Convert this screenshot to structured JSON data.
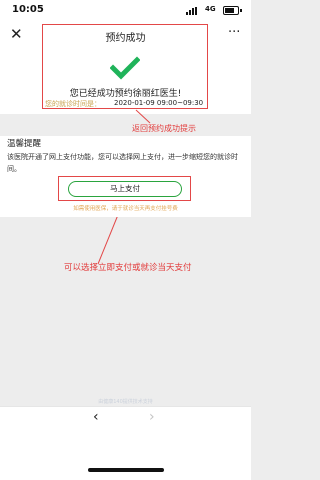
{
  "status_bar": {
    "time": "10:05",
    "network": "4G"
  },
  "nav": {
    "close_glyph": "✕",
    "title": "预约成功",
    "more_glyph": "···"
  },
  "success": {
    "icon": "check-icon",
    "message": "您已经成功预约徐丽红医生!",
    "time_label": "您的就诊时间是：",
    "time_value": "2020-01-09 09:00~09:30"
  },
  "annotations": {
    "success_hint": "返回预约成功提示",
    "pay_hint": "可以选择立即支付或就诊当天支付",
    "color": "#e34848"
  },
  "notice": {
    "title": "温馨提醒",
    "text": "该医院开通了网上支付功能，您可以选择网上支付，进一步缩短您的就诊时间。",
    "pay_button": "马上支付",
    "pay_hint": "如需使用医保，请于就诊当天再支付挂号费"
  },
  "footer": {
    "note": "由健康140提供技术支持"
  },
  "browser_bar": {
    "back_glyph": "‹",
    "forward_glyph": "›"
  },
  "colors": {
    "accent_green": "#2aa43e",
    "check_green": "#1fb35a",
    "annotation_red": "#e34848",
    "hint_orange": "#e2a552"
  }
}
